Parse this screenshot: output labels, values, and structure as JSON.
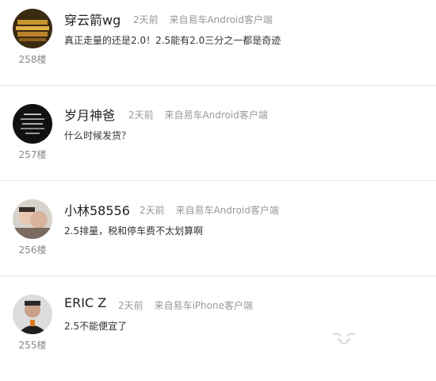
{
  "comments": [
    {
      "username": "穿云箭wg",
      "time": "2天前",
      "source": "来自易车Android客户端",
      "content": "真正走量的还是2.0！2.5能有2.0三分之一都是奇迹",
      "floor": "258楼"
    },
    {
      "username": "岁月神爸",
      "time": "2天前",
      "source": "来自易车Android客户端",
      "content": "什么时候发货？",
      "floor": "257楼"
    },
    {
      "username": "小林58556",
      "time": "2天前",
      "source": "来自易车Android客户端",
      "content": "2.5排量，税和停车费不太划算啊",
      "floor": "256楼"
    },
    {
      "username": "ERIC Z",
      "time": "2天前",
      "source": "来自易车iPhone客户端",
      "content": "2.5不能便宜了",
      "floor": "255楼"
    }
  ]
}
